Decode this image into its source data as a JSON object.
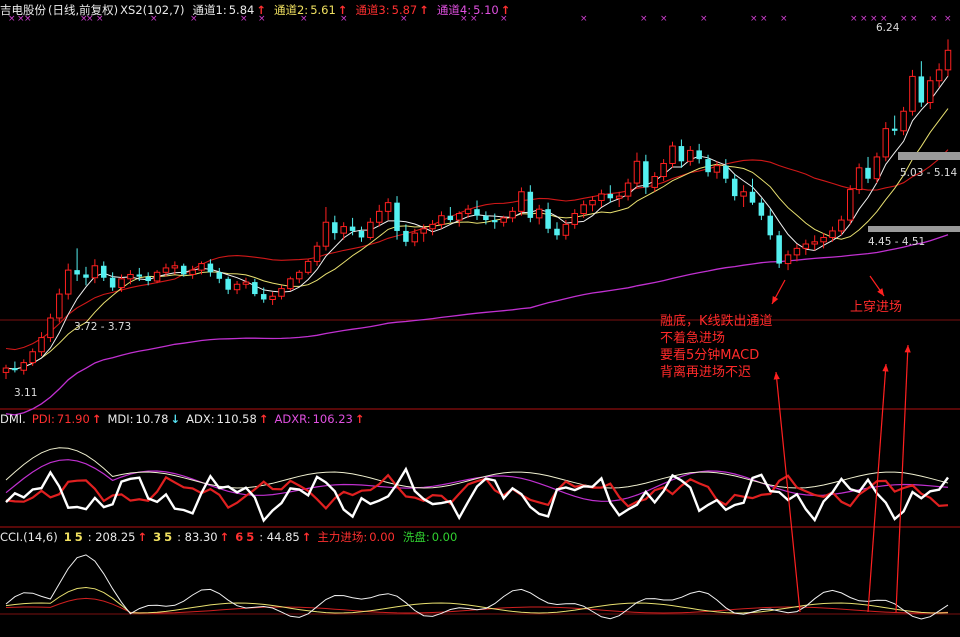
{
  "header1": {
    "name": "吉电股份",
    "period": "(日线,前复权)",
    "indicator": "XS2(102,7)",
    "ch1_label": "通道1:",
    "ch1_value": "5.84",
    "ch2_label": "通道2:",
    "ch2_value": "5.61",
    "ch3_label": "通道3:",
    "ch3_value": "5.87",
    "ch4_label": "通道4:",
    "ch4_value": "5.10"
  },
  "header2": {
    "name": "DMI.",
    "pdi_label": "PDI:",
    "pdi_value": "71.90",
    "mdi_label": "MDI:",
    "mdi_value": "10.78",
    "adx_label": "ADX:",
    "adx_value": "110.58",
    "adxr_label": "ADXR:",
    "adxr_value": "106.23"
  },
  "header3": {
    "name": "CCI.(14,6)",
    "l15": "15",
    "v15": ": 208.25",
    "l35": "35",
    "v35": ": 83.30",
    "l65": "65",
    "v65": ": 44.85",
    "main_label": "主力进场:",
    "main_value": "0.00",
    "wash_label": "洗盘:",
    "wash_value": "0.00"
  },
  "price_labels": {
    "high": "6.24",
    "range_a": "3.72 - 3.73",
    "low": "3.11",
    "range_b": "5.03 - 5.14",
    "range_c": "4.45 - 4.51"
  },
  "annotations": {
    "left_lines": [
      "融底，K线跌出通道",
      "不着急进场",
      "要看5分钟MACD",
      "背离再进场不迟"
    ],
    "right": "上穿进场"
  },
  "colors": {
    "up": "#ff2020",
    "down": "#54f0f0",
    "ma_white": "#f0f0f0",
    "ma_yellow": "#e8e070",
    "band_red": "#d01818",
    "band_magenta": "#c030d0",
    "marker": "#d040d0"
  },
  "chart_data": {
    "type": "candlestick",
    "y_range_main": [
      3.0,
      6.4
    ],
    "candles": [
      [
        3.18,
        3.25,
        3.12,
        3.22
      ],
      [
        3.22,
        3.28,
        3.18,
        3.2
      ],
      [
        3.2,
        3.3,
        3.16,
        3.27
      ],
      [
        3.27,
        3.4,
        3.24,
        3.37
      ],
      [
        3.37,
        3.55,
        3.33,
        3.5
      ],
      [
        3.5,
        3.72,
        3.46,
        3.68
      ],
      [
        3.68,
        3.95,
        3.64,
        3.9
      ],
      [
        3.9,
        4.18,
        3.85,
        4.12
      ],
      [
        4.12,
        4.32,
        4.02,
        4.08
      ],
      [
        4.08,
        4.15,
        3.98,
        4.05
      ],
      [
        4.05,
        4.22,
        4.0,
        4.16
      ],
      [
        4.16,
        4.2,
        4.02,
        4.05
      ],
      [
        4.05,
        4.1,
        3.93,
        3.96
      ],
      [
        3.96,
        4.08,
        3.92,
        4.04
      ],
      [
        4.04,
        4.12,
        3.99,
        4.08
      ],
      [
        4.08,
        4.14,
        4.02,
        4.06
      ],
      [
        4.06,
        4.1,
        3.98,
        4.02
      ],
      [
        4.02,
        4.12,
        4.0,
        4.1
      ],
      [
        4.1,
        4.18,
        4.06,
        4.14
      ],
      [
        4.14,
        4.2,
        4.08,
        4.16
      ],
      [
        4.16,
        4.18,
        4.06,
        4.08
      ],
      [
        4.08,
        4.16,
        4.04,
        4.12
      ],
      [
        4.12,
        4.2,
        4.08,
        4.18
      ],
      [
        4.18,
        4.22,
        4.06,
        4.1
      ],
      [
        4.1,
        4.14,
        4.0,
        4.04
      ],
      [
        4.04,
        4.06,
        3.9,
        3.94
      ],
      [
        3.94,
        4.02,
        3.9,
        3.99
      ],
      [
        3.99,
        4.05,
        3.95,
        4.01
      ],
      [
        4.01,
        4.04,
        3.88,
        3.9
      ],
      [
        3.9,
        3.96,
        3.82,
        3.85
      ],
      [
        3.85,
        3.92,
        3.8,
        3.88
      ],
      [
        3.88,
        3.98,
        3.85,
        3.95
      ],
      [
        3.95,
        4.06,
        3.93,
        4.04
      ],
      [
        4.04,
        4.12,
        4.0,
        4.1
      ],
      [
        4.1,
        4.22,
        4.08,
        4.2
      ],
      [
        4.2,
        4.38,
        4.16,
        4.34
      ],
      [
        4.34,
        4.7,
        4.3,
        4.56
      ],
      [
        4.56,
        4.62,
        4.4,
        4.46
      ],
      [
        4.46,
        4.56,
        4.4,
        4.52
      ],
      [
        4.52,
        4.6,
        4.44,
        4.48
      ],
      [
        4.48,
        4.52,
        4.38,
        4.42
      ],
      [
        4.42,
        4.6,
        4.4,
        4.56
      ],
      [
        4.56,
        4.72,
        4.52,
        4.66
      ],
      [
        4.66,
        4.78,
        4.58,
        4.74
      ],
      [
        4.74,
        4.8,
        4.4,
        4.48
      ],
      [
        4.48,
        4.54,
        4.34,
        4.38
      ],
      [
        4.38,
        4.5,
        4.34,
        4.46
      ],
      [
        4.46,
        4.54,
        4.38,
        4.5
      ],
      [
        4.5,
        4.58,
        4.44,
        4.54
      ],
      [
        4.54,
        4.66,
        4.5,
        4.62
      ],
      [
        4.62,
        4.7,
        4.56,
        4.58
      ],
      [
        4.58,
        4.66,
        4.52,
        4.64
      ],
      [
        4.64,
        4.72,
        4.6,
        4.68
      ],
      [
        4.68,
        4.76,
        4.58,
        4.62
      ],
      [
        4.62,
        4.66,
        4.54,
        4.58
      ],
      [
        4.58,
        4.64,
        4.5,
        4.56
      ],
      [
        4.56,
        4.62,
        4.52,
        4.6
      ],
      [
        4.6,
        4.7,
        4.56,
        4.66
      ],
      [
        4.66,
        4.88,
        4.62,
        4.84
      ],
      [
        4.84,
        4.9,
        4.56,
        4.6
      ],
      [
        4.6,
        4.72,
        4.54,
        4.68
      ],
      [
        4.68,
        4.74,
        4.46,
        4.5
      ],
      [
        4.5,
        4.56,
        4.4,
        4.44
      ],
      [
        4.44,
        4.58,
        4.4,
        4.54
      ],
      [
        4.54,
        4.68,
        4.5,
        4.64
      ],
      [
        4.64,
        4.76,
        4.6,
        4.72
      ],
      [
        4.72,
        4.8,
        4.66,
        4.76
      ],
      [
        4.76,
        4.86,
        4.7,
        4.82
      ],
      [
        4.82,
        4.9,
        4.74,
        4.78
      ],
      [
        4.78,
        4.84,
        4.7,
        4.8
      ],
      [
        4.8,
        4.96,
        4.76,
        4.92
      ],
      [
        4.92,
        5.2,
        4.88,
        5.12
      ],
      [
        5.12,
        5.18,
        4.82,
        4.88
      ],
      [
        4.88,
        5.02,
        4.84,
        4.98
      ],
      [
        4.98,
        5.14,
        4.94,
        5.1
      ],
      [
        5.1,
        5.3,
        5.06,
        5.26
      ],
      [
        5.26,
        5.32,
        5.06,
        5.12
      ],
      [
        5.12,
        5.26,
        5.08,
        5.22
      ],
      [
        5.22,
        5.28,
        5.1,
        5.14
      ],
      [
        5.14,
        5.18,
        4.98,
        5.02
      ],
      [
        5.02,
        5.12,
        4.96,
        5.08
      ],
      [
        5.08,
        5.14,
        4.92,
        4.96
      ],
      [
        4.96,
        5.0,
        4.76,
        4.8
      ],
      [
        4.8,
        4.9,
        4.7,
        4.84
      ],
      [
        4.84,
        4.96,
        4.72,
        4.74
      ],
      [
        4.74,
        4.78,
        4.58,
        4.62
      ],
      [
        4.62,
        4.68,
        4.4,
        4.44
      ],
      [
        4.44,
        4.48,
        4.14,
        4.18
      ],
      [
        4.18,
        4.3,
        4.12,
        4.26
      ],
      [
        4.26,
        4.36,
        4.2,
        4.32
      ],
      [
        4.32,
        4.4,
        4.26,
        4.36
      ],
      [
        4.36,
        4.44,
        4.3,
        4.38
      ],
      [
        4.38,
        4.46,
        4.32,
        4.42
      ],
      [
        4.42,
        4.52,
        4.38,
        4.48
      ],
      [
        4.48,
        4.62,
        4.44,
        4.58
      ],
      [
        4.58,
        4.9,
        4.54,
        4.86
      ],
      [
        4.86,
        5.1,
        4.82,
        5.06
      ],
      [
        5.06,
        5.16,
        4.92,
        4.96
      ],
      [
        4.96,
        5.2,
        4.92,
        5.16
      ],
      [
        5.16,
        5.48,
        5.12,
        5.42
      ],
      [
        5.42,
        5.54,
        5.36,
        5.4
      ],
      [
        5.4,
        5.62,
        5.36,
        5.58
      ],
      [
        5.58,
        5.96,
        5.54,
        5.9
      ],
      [
        5.9,
        6.04,
        5.62,
        5.66
      ],
      [
        5.66,
        5.9,
        5.6,
        5.86
      ],
      [
        5.86,
        6.02,
        5.8,
        5.96
      ],
      [
        5.96,
        6.24,
        5.9,
        6.14
      ]
    ]
  }
}
